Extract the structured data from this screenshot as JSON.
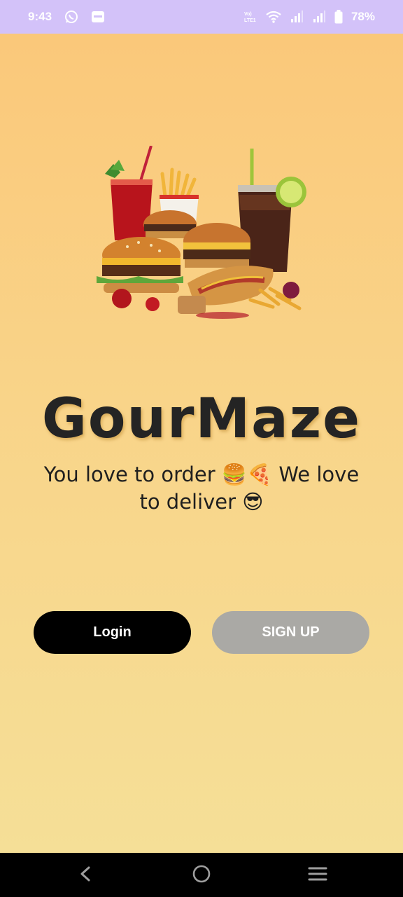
{
  "status_bar": {
    "time": "9:43",
    "battery_percent": "78%",
    "volte_label": "Vo) LTE1",
    "left_icons": [
      "whatsapp-icon",
      "app-notification-icon"
    ],
    "right_icons": [
      "volte-icon",
      "wifi-icon",
      "signal-icon",
      "signal-icon",
      "battery-icon"
    ],
    "background_color": "#d3c2f9"
  },
  "app": {
    "brand_name": "GourMaze",
    "tagline_line1": "You love to order 🍔🍕 We love",
    "tagline_line2": "to deliver 😎",
    "hero_image": "fast-food-illustration",
    "login_label": "Login",
    "signup_label": "SIGN UP",
    "colors": {
      "login_bg": "#000000",
      "signup_bg": "#aaa9a5",
      "gradient_top": "#fac87a",
      "gradient_bottom": "#f5df97"
    }
  },
  "nav_bar": {
    "buttons": [
      "back-icon",
      "home-icon",
      "menu-icon"
    ]
  }
}
